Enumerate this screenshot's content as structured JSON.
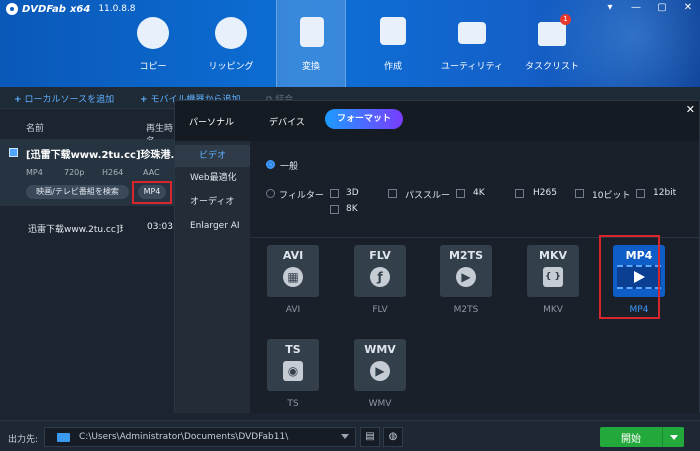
{
  "app": {
    "name": "DVDFab",
    "edition": "x64",
    "version": "11.0.8.8"
  },
  "window_controls": [
    "▾",
    "—",
    "▢",
    "✕"
  ],
  "nav": [
    {
      "label": "コピー",
      "icon": "disc-copy-icon",
      "active": false
    },
    {
      "label": "リッピング",
      "icon": "disc-rip-icon",
      "active": false
    },
    {
      "label": "変換",
      "icon": "convert-film-icon",
      "active": true
    },
    {
      "label": "作成",
      "icon": "create-video-icon",
      "active": false
    },
    {
      "label": "ユーティリティ",
      "icon": "toolbox-icon",
      "active": false
    },
    {
      "label": "タスクリスト",
      "icon": "task-list-icon",
      "active": false,
      "badge": "1"
    }
  ],
  "toolbar": {
    "add_local": "ローカルソースを追加",
    "add_mobile": "モバイル機器から追加",
    "merge": "結合"
  },
  "list": {
    "headers": {
      "name": "名前",
      "duration": "再生時名"
    },
    "files": [
      {
        "title": "[迅雷下载www.2tu.cc]珍珠港.BD",
        "meta": [
          "MP4",
          "720p",
          "H264",
          "AAC"
        ],
        "profile_button": "映画/テレビ番組を検索",
        "format_button": "MP4"
      },
      {
        "title": "迅雷下载www.2tu.cc]珍珠港",
        "duration": "03:03:0"
      }
    ]
  },
  "panel": {
    "tabs": [
      "パーソナル",
      "デバイス",
      "フォーマット"
    ],
    "selected_tab": "フォーマット",
    "sidebar": [
      "ビデオ",
      "Web最適化",
      "オーディオ",
      "Enlarger AI"
    ],
    "selected_sidebar": "ビデオ",
    "mode_general": "一般",
    "filter_label": "フィルター",
    "filters": [
      "3D",
      "パススルー",
      "4K",
      "H265",
      "10ビット",
      "12bit",
      "8K"
    ],
    "formats": [
      {
        "badge": "AVI",
        "name": "AVI",
        "glyph": "▦"
      },
      {
        "badge": "FLV",
        "name": "FLV",
        "glyph": "ƒ"
      },
      {
        "badge": "M2TS",
        "name": "M2TS",
        "glyph": "▶"
      },
      {
        "badge": "MKV",
        "name": "MKV",
        "glyph": "{ }"
      },
      {
        "badge": "MP4",
        "name": "MP4",
        "glyph": "▶"
      },
      {
        "badge": "TS",
        "name": "TS",
        "glyph": "◉"
      },
      {
        "badge": "WMV",
        "name": "WMV",
        "glyph": "▶"
      }
    ],
    "selected_format": "MP4"
  },
  "bottom": {
    "output_label": "出力先:",
    "output_path": "C:\\Users\\Administrator\\Documents\\DVDFab11\\",
    "start_label": "開始"
  },
  "colors": {
    "accent_blue": "#3d9bff",
    "highlight_red": "#d8262d",
    "start_green": "#23a83c"
  }
}
